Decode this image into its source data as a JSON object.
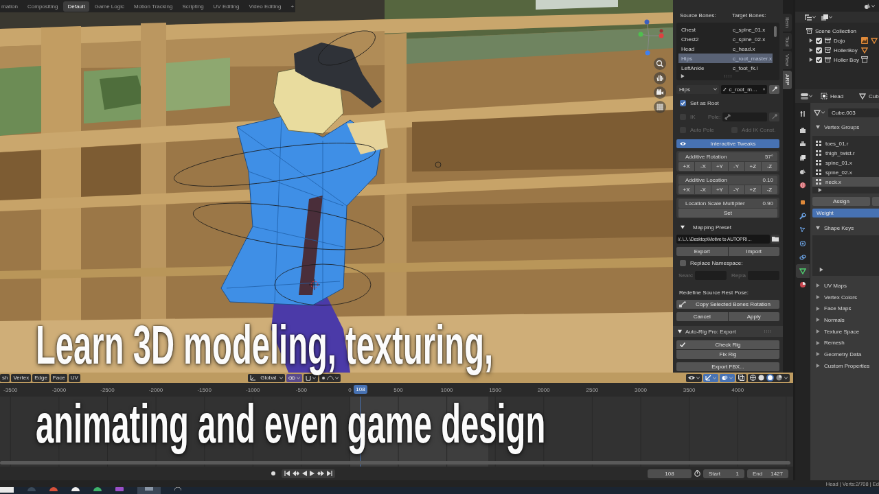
{
  "workspaces": {
    "tabs": [
      {
        "label": "mation",
        "selected": false
      },
      {
        "label": "Compositing",
        "selected": false
      },
      {
        "label": "Default",
        "selected": true
      },
      {
        "label": "Game Logic",
        "selected": false
      },
      {
        "label": "Motion Tracking",
        "selected": false
      },
      {
        "label": "Scripting",
        "selected": false
      },
      {
        "label": "UV Editing",
        "selected": false
      },
      {
        "label": "Video Editing",
        "selected": false
      }
    ],
    "add": "+"
  },
  "viewport": {
    "menus": [
      "sh",
      "Vertex",
      "Edge",
      "Face",
      "UV"
    ],
    "orientation": "Global",
    "caption": [
      "Learn 3D modeling, texturing,",
      "animating and even game design"
    ]
  },
  "sidebar": {
    "tabs": [
      {
        "label": "Item",
        "selected": false
      },
      {
        "label": "Tool",
        "selected": false
      },
      {
        "label": "View",
        "selected": false
      },
      {
        "label": "ARP",
        "selected": true
      }
    ],
    "columns": [
      "Source Bones:",
      "Target Bones:"
    ],
    "bones": [
      {
        "source": "Chest",
        "target": "c_spine_01.x",
        "selected": false
      },
      {
        "source": "Chest2",
        "target": "c_spine_02.x",
        "selected": false
      },
      {
        "source": "Head",
        "target": "c_head.x",
        "selected": false
      },
      {
        "source": "Hips",
        "target": "c_root_master.x",
        "selected": true
      },
      {
        "source": "LeftAnkle",
        "target": "c_foot_fk.l",
        "selected": false
      }
    ],
    "source_bone": "Hips",
    "target_bone": "c_root_m…",
    "set_as_root": {
      "label": "Set as Root",
      "checked": true,
      "disabled": false
    },
    "ik": {
      "label": "IK",
      "checked": false,
      "disabled": true
    },
    "pole": {
      "label": "Pole:",
      "disabled": true
    },
    "auto_pole": {
      "label": "Auto Pole",
      "checked": false,
      "disabled": true
    },
    "add_ik_const": {
      "label": "Add IK Const.",
      "checked": false,
      "disabled": true
    },
    "interactive_tweaks": {
      "label": "Interactive Tweaks",
      "on": true
    },
    "tweaks": [
      {
        "label": "Additive Rotation",
        "value": "57°",
        "axes": [
          "+X",
          "-X",
          "+Y",
          "-Y",
          "+Z",
          "-Z"
        ]
      },
      {
        "label": "Additive Location",
        "value": "0.10",
        "axes": [
          "+X",
          "-X",
          "+Y",
          "-Y",
          "+Z",
          "-Z"
        ]
      }
    ],
    "scale_multiplier": {
      "label": "Location Scale Multiplier",
      "value": "0.90",
      "button": "Set"
    },
    "mapping_preset": {
      "title": "Mapping Preset",
      "expanded": true,
      "path": "//..\\..\\..\\Desktop\\Motive to AUTOPRI…",
      "buttons": [
        "Export",
        "Import"
      ],
      "replace_namespace": {
        "label": "Replace Namespace:",
        "checked": false
      },
      "namespace_fields": [
        {
          "label": "Searc",
          "disabled": true
        },
        {
          "label": "Repla",
          "disabled": true
        }
      ],
      "rest_pose_label": "Redefine Source Rest Pose:",
      "copy_button": "Copy Selected Bones Rotation",
      "actions": [
        "Cancel",
        "Apply"
      ]
    },
    "export_panel": {
      "title": "Auto-Rig Pro: Export",
      "expanded": true,
      "checks": [
        {
          "label": "Check Rig",
          "checked": true
        },
        {
          "label": "Fix Rig",
          "checked": false
        }
      ],
      "export_button": "Export FBX..."
    }
  },
  "outliner": {
    "root": "Scene Collection",
    "items": [
      {
        "label": "Dojo",
        "checked": true
      },
      {
        "label": "HollerBoy",
        "checked": true
      },
      {
        "label": "Holler Boy",
        "checked": true
      }
    ]
  },
  "properties": {
    "object": "Head",
    "data": "Cub",
    "mesh": "Cube.003",
    "tab_groups": [
      [
        {
          "kind": "tool",
          "selected": false
        }
      ],
      [
        {
          "kind": "render",
          "selected": false
        },
        {
          "kind": "output",
          "selected": false
        },
        {
          "kind": "view_layer",
          "selected": false
        },
        {
          "kind": "scene",
          "selected": false
        },
        {
          "kind": "world",
          "selected": false
        }
      ],
      [
        {
          "kind": "object",
          "selected": false
        },
        {
          "kind": "modifiers",
          "selected": false
        },
        {
          "kind": "particles",
          "selected": false
        },
        {
          "kind": "physics",
          "selected": false
        },
        {
          "kind": "constraints",
          "selected": false
        },
        {
          "kind": "data",
          "selected": true
        },
        {
          "kind": "material",
          "selected": false
        }
      ]
    ],
    "vertex_groups": {
      "title": "Vertex Groups",
      "expanded": true,
      "items": [
        {
          "label": "toes_01.r",
          "selected": false
        },
        {
          "label": "thigh_twist.r",
          "selected": false
        },
        {
          "label": "spine_01.x",
          "selected": false
        },
        {
          "label": "spine_02.x",
          "selected": false
        },
        {
          "label": "neck.x",
          "selected": true
        }
      ],
      "assign": "Assign",
      "weight": {
        "label": "Weight",
        "level": 1
      }
    },
    "shape_keys": {
      "title": "Shape Keys",
      "expanded": true
    },
    "panels": [
      {
        "title": "UV Maps",
        "expanded": false
      },
      {
        "title": "Vertex Colors",
        "expanded": false
      },
      {
        "title": "Face Maps",
        "expanded": false
      },
      {
        "title": "Normals",
        "expanded": false
      },
      {
        "title": "Texture Space",
        "expanded": false
      },
      {
        "title": "Remesh",
        "expanded": false
      },
      {
        "title": "Geometry Data",
        "expanded": false
      },
      {
        "title": "Custom Properties",
        "expanded": false
      }
    ]
  },
  "timeline": {
    "ruler": [
      "-3500",
      "-3000",
      "-2500",
      "-2000",
      "-1500",
      "-1000",
      "-500",
      "0",
      "500",
      "1000",
      "1500",
      "2000",
      "2500",
      "3000",
      "3500",
      "4000"
    ],
    "current_frame": "108",
    "frame_field": "108",
    "start": {
      "label": "Start",
      "value": "1"
    },
    "end": {
      "label": "End",
      "value": "1427"
    }
  },
  "status_bar": {
    "text": "Head | Verts:2/708 | Ed"
  }
}
